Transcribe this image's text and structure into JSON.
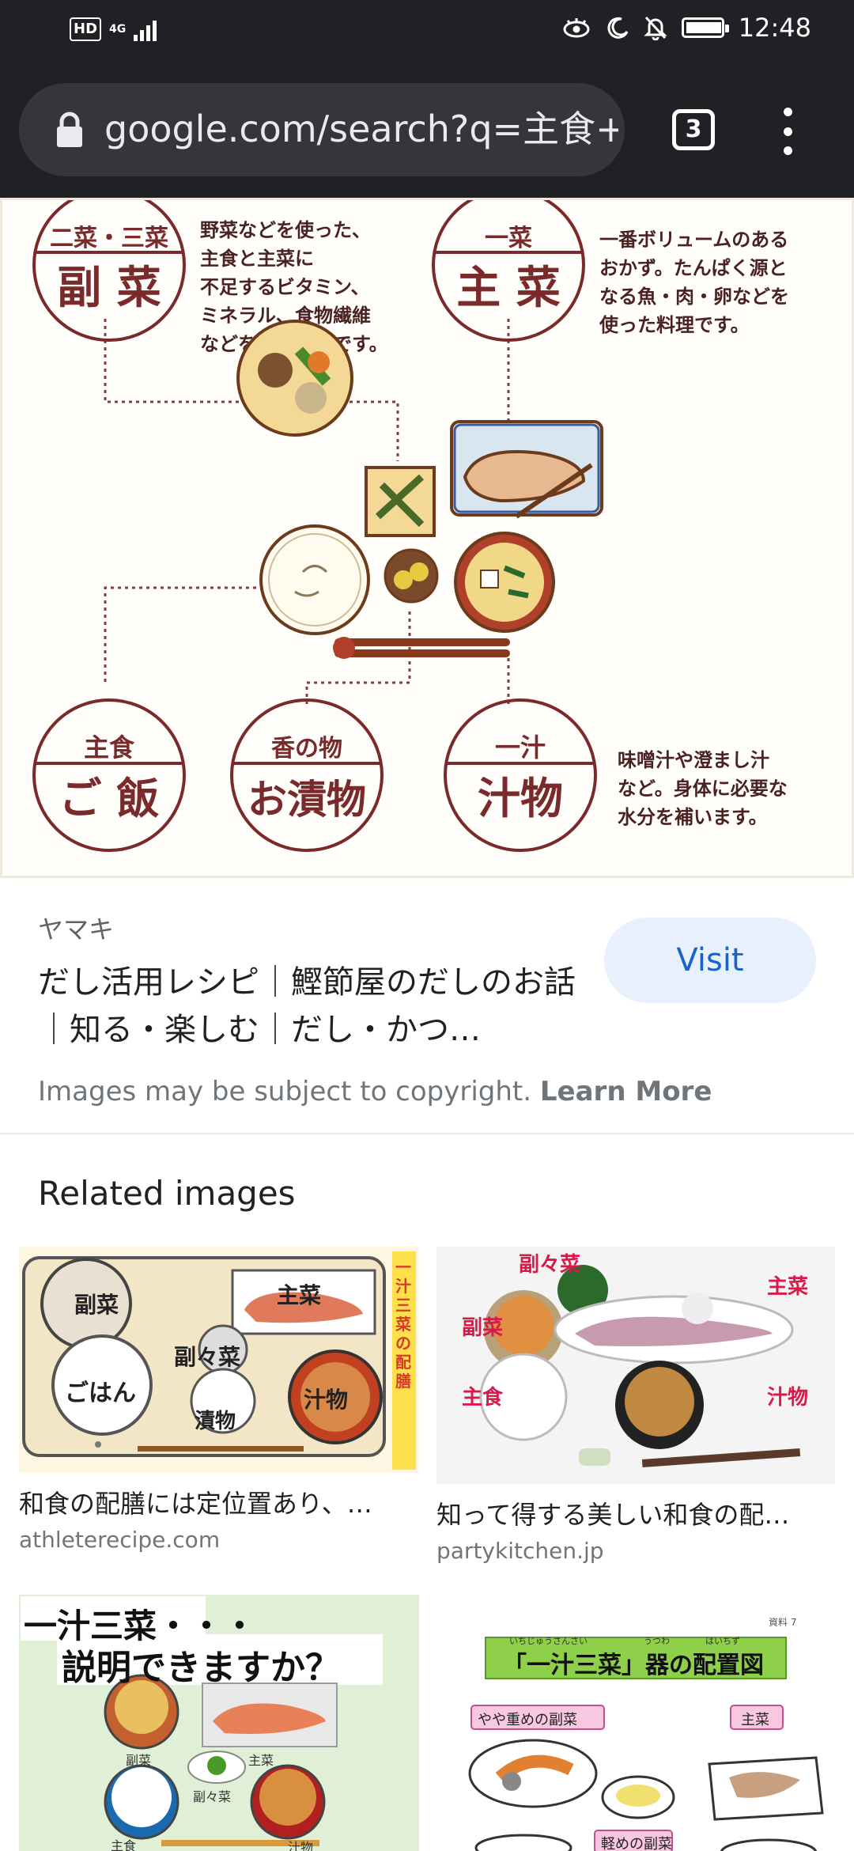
{
  "status_bar": {
    "hd": "HD",
    "network": "4G",
    "time": "12:48"
  },
  "browser": {
    "url": "google.com/search?q=主食+三",
    "tab_count": "3"
  },
  "main_image": {
    "tl_top": "二菜・三菜",
    "tl_main": "副 菜",
    "tl_desc": [
      "野菜などを使った、",
      "主食と主菜に",
      "不足するビタミン、",
      "ミネラル、食物繊維",
      "などを補う料理です。"
    ],
    "tr_top": "一菜",
    "tr_main": "主 菜",
    "tr_desc": [
      "一番ボリュームのある",
      "おかず。たんぱく源と",
      "なる魚・肉・卵などを",
      "使った料理です。"
    ],
    "bl_top": "主食",
    "bl_main": "ご 飯",
    "bm_top": "香の物",
    "bm_main": "お漬物",
    "br_top": "一汁",
    "br_main": "汁物",
    "br_desc": [
      "味噌汁や澄まし汁",
      "など。身体に必要な",
      "水分を補います。"
    ]
  },
  "result": {
    "source": "ヤマキ",
    "title": "だし活用レシピ｜鰹節屋のだしのお話｜知る・楽しむ｜だし・かつ…",
    "visit_label": "Visit",
    "copyright_text": "Images may be subject to copyright.",
    "learn_more": "Learn More"
  },
  "related": {
    "heading": "Related images",
    "items": [
      {
        "caption": "和食の配膳には定位置あり、…",
        "domain": "athleterecipe.com",
        "labels": [
          "副菜",
          "主菜",
          "副々菜",
          "ごはん",
          "漬物",
          "汁物",
          "一汁三菜の配膳"
        ]
      },
      {
        "caption": "知って得する美しい和食の配…",
        "domain": "partykitchen.jp",
        "labels": [
          "副々菜",
          "主菜",
          "副菜",
          "主食",
          "汁物"
        ]
      },
      {
        "caption": "",
        "domain": "",
        "labels": [
          "一汁三菜・・・",
          "説明できますか？",
          "副菜",
          "主菜",
          "副々菜",
          "主食",
          "汁物"
        ]
      },
      {
        "caption": "",
        "domain": "",
        "labels": [
          "資料 7",
          "「一汁三菜」器の配置図",
          "いちじゅうさんさい",
          "うつわ",
          "はいちず",
          "やや重めの副菜",
          "主菜",
          "軽めの副菜"
        ]
      }
    ]
  },
  "colors": {
    "chrome": "#202124",
    "pill": "#35363a",
    "visit_bg": "#e8f0fe",
    "visit_text": "#1a64c8",
    "maroon": "#7a2a2a"
  }
}
